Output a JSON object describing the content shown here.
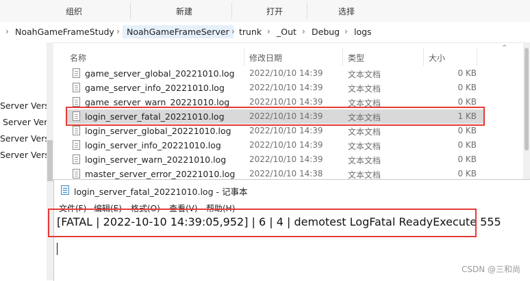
{
  "ribbon": {
    "groups": [
      "组织",
      "新建",
      "打开",
      "选择"
    ]
  },
  "breadcrumb": [
    "NoahGameFrameStudy",
    "NoahGameFrameServer",
    "trunk",
    "_Out",
    "Debug",
    "logs"
  ],
  "nav": {
    "items": [
      "Server Vers",
      "Server Ver",
      "Server Vers",
      "Server Vers"
    ]
  },
  "columns": {
    "name": "名称",
    "date": "修改日期",
    "type": "类型",
    "size": "大小"
  },
  "files": [
    {
      "name": "game_server_global_20221010.log",
      "date": "2022/10/10 14:39",
      "type": "文本文档",
      "size": "0 KB"
    },
    {
      "name": "game_server_info_20221010.log",
      "date": "2022/10/10 14:39",
      "type": "文本文档",
      "size": "0 KB"
    },
    {
      "name": "game_server_warn_20221010.log",
      "date": "2022/10/10 14:39",
      "type": "文本文档",
      "size": "0 KB"
    },
    {
      "name": "login_server_fatal_20221010.log",
      "date": "2022/10/10 14:39",
      "type": "文本文档",
      "size": "1 KB"
    },
    {
      "name": "login_server_global_20221010.log",
      "date": "2022/10/10 14:39",
      "type": "文本文档",
      "size": "0 KB"
    },
    {
      "name": "login_server_info_20221010.log",
      "date": "2022/10/10 14:39",
      "type": "文本文档",
      "size": "0 KB"
    },
    {
      "name": "login_server_warn_20221010.log",
      "date": "2022/10/10 14:39",
      "type": "文本文档",
      "size": "0 KB"
    },
    {
      "name": "master_server_error_20221010.log",
      "date": "2022/10/10 14:38",
      "type": "文本文档",
      "size": "0 KB"
    }
  ],
  "notepad": {
    "title": "login_server_fatal_20221010.log - 记事本",
    "menu": [
      "文件(F)",
      "编辑(E)",
      "格式(O)",
      "查看(V)",
      "帮助(H)"
    ],
    "content": "[FATAL | 2022-10-10 14:39:05,952] | 6 | 4 | demotest LogFatal ReadyExecute 555"
  },
  "watermark": "CSDN @三和尚",
  "colors": {
    "highlight_box": "#e53935",
    "selected_row": "#d9d9d9"
  }
}
